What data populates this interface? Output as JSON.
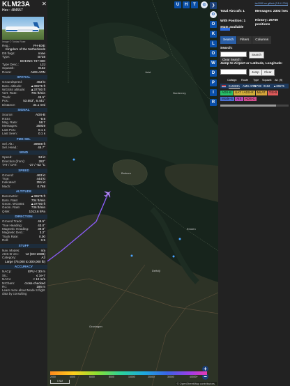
{
  "aircraft": {
    "callsign": "KLM23A",
    "hex_label": "Hex :",
    "hex": "484557",
    "photo_credit": "Image © Tobias Rose"
  },
  "info_rows_top": [
    {
      "k": "Reg.:",
      "v": "PH-BXE"
    },
    {
      "k": "",
      "v": "Kingdom of the Netherlands"
    },
    {
      "k": "DB flags:",
      "v": "none"
    },
    {
      "k": "Type:",
      "v": "B738"
    },
    {
      "k": "",
      "v": "BOEING 737-800"
    },
    {
      "k": "Type Desc.:",
      "v": "L2J"
    },
    {
      "k": "Squawk:",
      "v": "0152"
    },
    {
      "k": "Route:",
      "v": "AMS-ARN"
    }
  ],
  "sections": {
    "spatial": "SPATIAL",
    "signal": "SIGNAL",
    "fms_sel": "FMS SEL",
    "wind": "WIND",
    "speed": "SPEED",
    "altitude": "ALTITUDE",
    "direction": "DIRECTION",
    "stuff": "STUFF",
    "accuracy": "ACCURACY"
  },
  "spatial_rows": [
    {
      "k": "Groundspeed:",
      "v": "463 kt"
    },
    {
      "k": "Baro. altitude:",
      "v": "▲36575 ft"
    },
    {
      "k": "WGS84 altitude:",
      "v": "▲37700 ft"
    },
    {
      "k": "Vert. Rate:",
      "v": "704 ft/min"
    },
    {
      "k": "Track:",
      "v": "46.5°"
    },
    {
      "k": "Pos.:",
      "v": "53.553°, 6.441°"
    },
    {
      "k": "Distance:",
      "v": "34.1 nmi"
    }
  ],
  "signal_rows": [
    {
      "k": "Source:",
      "v": "ADS-B"
    },
    {
      "k": "RSSI:",
      "v": "-9.8"
    },
    {
      "k": "Msg. Rate:",
      "v": "58.7"
    },
    {
      "k": "Messages:",
      "v": "25929"
    },
    {
      "k": "Last Pos.:",
      "v": "0.1 s"
    },
    {
      "k": "Last Seen:",
      "v": "0.1 s"
    }
  ],
  "fms_rows": [
    {
      "k": "Sel. Alt.:",
      "v": "39008 ft"
    },
    {
      "k": "Sel. Head.:",
      "v": "45.7°"
    }
  ],
  "wind_rows": [
    {
      "k": "Speed:",
      "v": "34 kt"
    },
    {
      "k": "Direction (from):",
      "v": "282°"
    },
    {
      "k": "TAT / OAT:",
      "v": "-27 / -53 °C"
    }
  ],
  "speed_rows": [
    {
      "k": "Ground:",
      "v": "463 kt"
    },
    {
      "k": "True:",
      "v": "444 kt"
    },
    {
      "k": "Indicated:",
      "v": "251 kt"
    },
    {
      "k": "Mach:",
      "v": "0.768"
    }
  ],
  "altitude_rows": [
    {
      "k": "Barometric:",
      "v": "▲36575 ft"
    },
    {
      "k": "Baro. Rate:",
      "v": "704 ft/min"
    },
    {
      "k": "Geom. WGS84:",
      "v": "▲37700 ft"
    },
    {
      "k": "Geom. Rate:",
      "v": "736 ft/min"
    },
    {
      "k": "QNH:",
      "v": "1013.6 hPa"
    }
  ],
  "direction_rows": [
    {
      "k": "Ground Track:",
      "v": "46.5°"
    },
    {
      "k": "True Heading:",
      "v": "43.0°"
    },
    {
      "k": "Magnetic Heading:",
      "v": "39.8°"
    },
    {
      "k": "Magnetic Decl.:",
      "v": "3.2°"
    },
    {
      "k": "Track Rate:",
      "v": "0.00"
    },
    {
      "k": "Roll:",
      "v": "0.5"
    }
  ],
  "stuff_rows": [
    {
      "k": "Nav. Modes:",
      "v": "n/a"
    },
    {
      "k": "ADS-B Ver.:",
      "v": "v2 (DO-260B)"
    },
    {
      "k": "Category:",
      "v": "A3"
    },
    {
      "k": "",
      "v": "Large (75,000 to 300,000 lb)"
    }
  ],
  "accuracy_rows": [
    {
      "k": "NACp:",
      "v": "EPU < 30 m"
    },
    {
      "k": "SIL:",
      "v": "≤ 1e-7"
    },
    {
      "k": "NACv:",
      "v": "< 10 m/s"
    },
    {
      "k": "NICbaro:",
      "v": "cross-checked"
    },
    {
      "k": "Rc:",
      "v": "186 m"
    }
  ],
  "memo": "Learn more about Mode S flight data by consulting",
  "map": {
    "top_buttons": [
      "U",
      "H",
      "T"
    ],
    "nav_buttons": [
      "O",
      "K",
      "L",
      "O",
      "W",
      "D",
      "P",
      "I",
      "R"
    ],
    "labels": [
      "Borkum",
      "Juist",
      "Norderney",
      "Emden",
      "Delfzijl",
      "Groningen"
    ],
    "legend_ticks": [
      "2000",
      "4000",
      "6000",
      "8000",
      "10000",
      "20000",
      "30000",
      "40000+"
    ],
    "scale": "5 NM",
    "attribution": "© OpenStreetMap contributors."
  },
  "stats": {
    "github": "tar1090 on github (3.14.1704)",
    "total_aircraft": "Total Aircraft: 1",
    "with_position": "With Position: 1",
    "messages": "Messages: 2302 /sec",
    "history": "History: 26769 positions",
    "stats_link": "Stats available"
  },
  "tabs": [
    "Search",
    "Filters",
    "Columns"
  ],
  "search": {
    "label": "Search:",
    "button": "Search",
    "clear_button": "Clear Search",
    "jump_label": "Jump to Airport or Latitude, Longitude:",
    "jump_button": "Jump",
    "clear_jump": "Clear"
  },
  "table": {
    "headers": [
      "",
      "Callsign",
      "Route",
      "Type",
      "Squawk",
      "Alt. (ft)"
    ],
    "row": {
      "callsign": "KLM23A",
      "route": "AMS-ARN",
      "type": "B738",
      "squawk": "0152",
      "alt": "▲36575"
    }
  },
  "source_chips": [
    {
      "label": "ADS-B",
      "color": "#28c26a"
    },
    {
      "label": "UAT / ADS-R",
      "color": "#d6b13a"
    },
    {
      "label": "MLAT",
      "color": "#d6a53a"
    },
    {
      "label": "TIS-B",
      "color": "#e05b5b"
    },
    {
      "label": "Mode-S",
      "color": "#4a6fd1"
    },
    {
      "label": "AIS",
      "color": "#bb4ab8"
    },
    {
      "label": "ADS-C",
      "color": "#d24e8c"
    }
  ],
  "colors": {
    "accent": "#0a4fa8",
    "sea": "#17241c",
    "land": "#2d3326",
    "trail": "#8b5cf6"
  }
}
